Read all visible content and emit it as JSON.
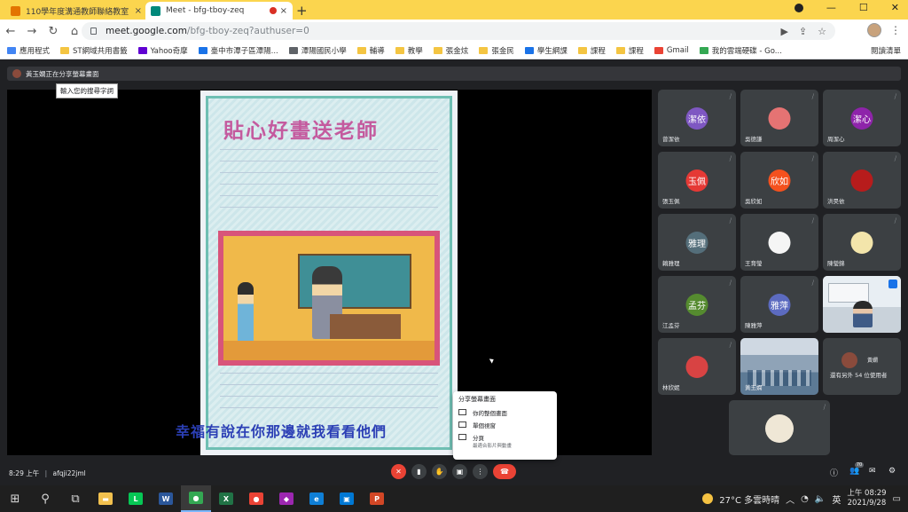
{
  "tabs": [
    {
      "title": "110學年度溝通教師聯絡教室",
      "close": "×",
      "favicon_color": "#e37400"
    },
    {
      "title": "Meet - bfg-tboy-zeq",
      "close": "×",
      "favicon_color": "#00897b"
    }
  ],
  "new_tab": "+",
  "window_controls": {
    "minimize": "—",
    "maximize": "☐",
    "close": "✕"
  },
  "toolbar": {
    "back": "←",
    "forward": "→",
    "reload": "↻",
    "home": "⌂",
    "url_host": "meet.google.com",
    "url_path": "/bfg-tboy-zeq?authuser=0",
    "star": "☆",
    "menu": "⋮"
  },
  "bookmarks": [
    {
      "label": "應用程式",
      "color": "#4285f4"
    },
    {
      "label": "ST網域共用書籤",
      "color": "#f4c542"
    },
    {
      "label": "Yahoo奇摩",
      "color": "#6001d2"
    },
    {
      "label": "臺中市潭子區潭陽...",
      "color": "#1a73e8"
    },
    {
      "label": "潭陽國民小學",
      "color": "#5f6368"
    },
    {
      "label": "輔導",
      "color": "#f4c542"
    },
    {
      "label": "教學",
      "color": "#f4c542"
    },
    {
      "label": "張金炫",
      "color": "#f4c542"
    },
    {
      "label": "張金民",
      "color": "#f4c542"
    },
    {
      "label": "學生網課",
      "color": "#1a73e8"
    },
    {
      "label": "課程",
      "color": "#f4c542"
    },
    {
      "label": "課程",
      "color": "#f4c542"
    },
    {
      "label": "Gmail",
      "color": "#ea4335"
    },
    {
      "label": "我的雲端硬碟 - Go...",
      "color": "#34a853"
    }
  ],
  "bookmarks_right": "閱讀清單",
  "meet": {
    "presenting_text": "黃玉嫻正在分享螢幕畫面",
    "tooltip": "輸入您的搜尋字詞",
    "drawing": {
      "title": "貼心好畫送老師",
      "caption": "幸福有說在你那邊就我看看他們"
    },
    "share_menu": {
      "title": "分享螢幕畫面",
      "items": [
        {
          "label": "你的整個畫面",
          "sub": ""
        },
        {
          "label": "單個視窗",
          "sub": ""
        },
        {
          "label": "分頁",
          "sub": "最適合影片與動畫"
        }
      ]
    },
    "tiles": [
      {
        "name": "曾潔依",
        "initials": "潔依",
        "color": "#7e57c2",
        "type": "avatar"
      },
      {
        "name": "吳德謙",
        "initials": "",
        "color": "#e57373",
        "type": "photo"
      },
      {
        "name": "周潔心",
        "initials": "潔心",
        "color": "#8e24aa",
        "type": "avatar"
      },
      {
        "name": "張玉佩",
        "initials": "玉佩",
        "color": "#e53935",
        "type": "avatar"
      },
      {
        "name": "吳欣如",
        "initials": "欣如",
        "color": "#f4511e",
        "type": "avatar"
      },
      {
        "name": "洪昊依",
        "initials": "",
        "color": "#b71c1c",
        "type": "photo"
      },
      {
        "name": "賴雅理",
        "initials": "雅理",
        "color": "#546e7a",
        "type": "avatar"
      },
      {
        "name": "王育瑩",
        "initials": "",
        "color": "#f5f5f5",
        "type": "photo"
      },
      {
        "name": "陳瑩錦",
        "initials": "",
        "color": "#f3e5ab",
        "type": "photo"
      },
      {
        "name": "江孟芬",
        "initials": "孟芬",
        "color": "#558b2f",
        "type": "avatar"
      },
      {
        "name": "陳雅萍",
        "initials": "雅萍",
        "color": "#5c6bc0",
        "type": "avatar"
      },
      {
        "name": "",
        "initials": "",
        "color": "#d7dde2",
        "type": "video"
      },
      {
        "name": "林欣妮",
        "initials": "",
        "color": "#d84343",
        "type": "photo"
      },
      {
        "name": "黃玉嫻",
        "initials": "",
        "color": "#8fa3b7",
        "type": "classroom"
      },
      {
        "name": "還有另外 54 位使用者",
        "initials": "",
        "color": "#202124",
        "type": "more"
      },
      {
        "name": "",
        "initials": "",
        "color": "#efe7d6",
        "type": "photo"
      }
    ],
    "more_badge": "黃嫻"
  },
  "bottombar": {
    "time": "8:29 上午",
    "meeting_code": "afqji22jml",
    "controls": [
      "mic-off",
      "camera",
      "hand",
      "present",
      "more",
      "leave"
    ],
    "participant_count": "70"
  },
  "taskbar": {
    "apps": [
      {
        "name": "file-explorer",
        "glyph": "▬",
        "color": "#f2c14e"
      },
      {
        "name": "line",
        "glyph": "L",
        "color": "#06c755"
      },
      {
        "name": "word",
        "glyph": "W",
        "color": "#2b579a"
      },
      {
        "name": "chrome",
        "glyph": "●",
        "color": "#34a853"
      },
      {
        "name": "excel",
        "glyph": "X",
        "color": "#217346"
      },
      {
        "name": "chrome-2",
        "glyph": "●",
        "color": "#ea4335"
      },
      {
        "name": "paint",
        "glyph": "◆",
        "color": "#9c27b0"
      },
      {
        "name": "edge",
        "glyph": "e",
        "color": "#0f7fd6"
      },
      {
        "name": "store",
        "glyph": "▣",
        "color": "#0078d4"
      },
      {
        "name": "powerpoint",
        "glyph": "P",
        "color": "#d24726"
      }
    ],
    "weather": "27°C 多雲時晴",
    "ime": "英",
    "time": "上午 08:29",
    "date": "2021/9/28"
  }
}
